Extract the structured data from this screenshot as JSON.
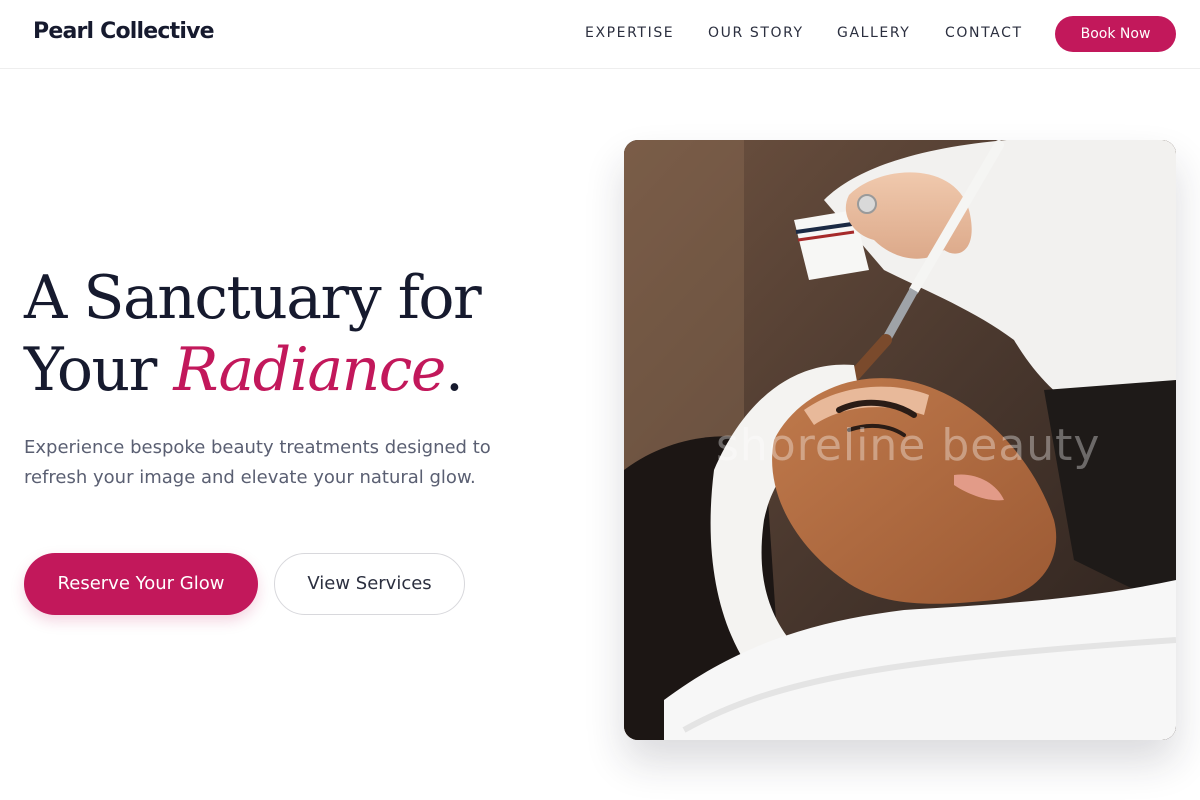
{
  "brand": {
    "name": "Pearl Collective",
    "accent_color": "#c2185b"
  },
  "nav": {
    "items": [
      {
        "label": "EXPERTISE"
      },
      {
        "label": "OUR STORY"
      },
      {
        "label": "GALLERY"
      },
      {
        "label": "CONTACT"
      }
    ],
    "cta_label": "Book Now"
  },
  "hero": {
    "title_line1": "A Sanctuary for",
    "title_line2_prefix": "Your ",
    "title_accent": "Radiance",
    "title_suffix": ".",
    "description": "Experience bespoke beauty treatments designed to refresh your image and elevate your natural glow.",
    "primary_cta": "Reserve Your Glow",
    "secondary_cta": "View Services",
    "image": {
      "subject": "facial-mask-treatment-photo",
      "watermark": "shoreline beauty"
    }
  }
}
